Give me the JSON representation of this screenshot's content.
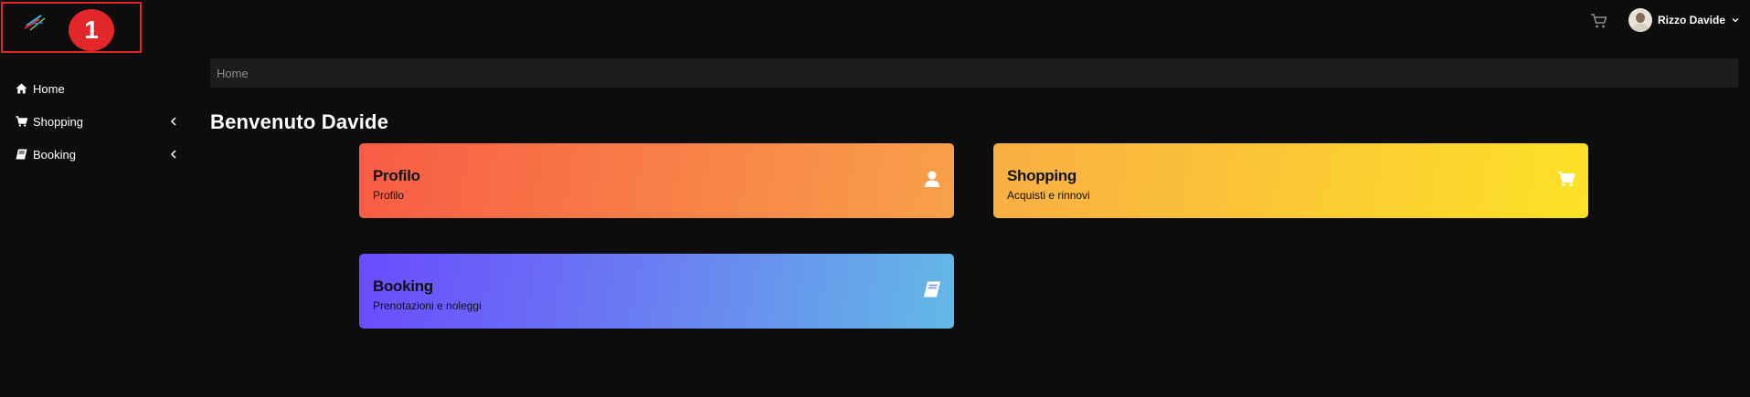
{
  "annotation": {
    "badge_number": "1"
  },
  "header": {
    "user_name": "Rizzo Davide",
    "icons": {
      "cart": "cart-icon",
      "user_menu": "chevron-down-icon"
    }
  },
  "sidebar": {
    "items": [
      {
        "label": "Home",
        "icon": "home-icon",
        "expandable": false
      },
      {
        "label": "Shopping",
        "icon": "cart-icon",
        "expandable": true
      },
      {
        "label": "Booking",
        "icon": "book-icon",
        "expandable": true
      }
    ]
  },
  "breadcrumb": {
    "current": "Home"
  },
  "main": {
    "title": "Benvenuto Davide",
    "cards": [
      {
        "title": "Profilo",
        "subtitle": "Profilo",
        "icon": "user-icon"
      },
      {
        "title": "Shopping",
        "subtitle": "Acquisti e rinnovi",
        "icon": "cart-icon"
      },
      {
        "title": "Booking",
        "subtitle": "Prenotazioni e noleggi",
        "icon": "book-icon"
      }
    ]
  },
  "colors": {
    "background": "#0d0d0d",
    "breadcrumb_bg": "#1d1d1d",
    "annotation_red": "#e3262a",
    "profilo_gradient": [
      "#f85c45",
      "#f8a14a"
    ],
    "shopping_gradient": [
      "#f9ae43",
      "#fde227"
    ],
    "booking_gradient": [
      "#6a4cfd",
      "#63b9e6"
    ]
  }
}
